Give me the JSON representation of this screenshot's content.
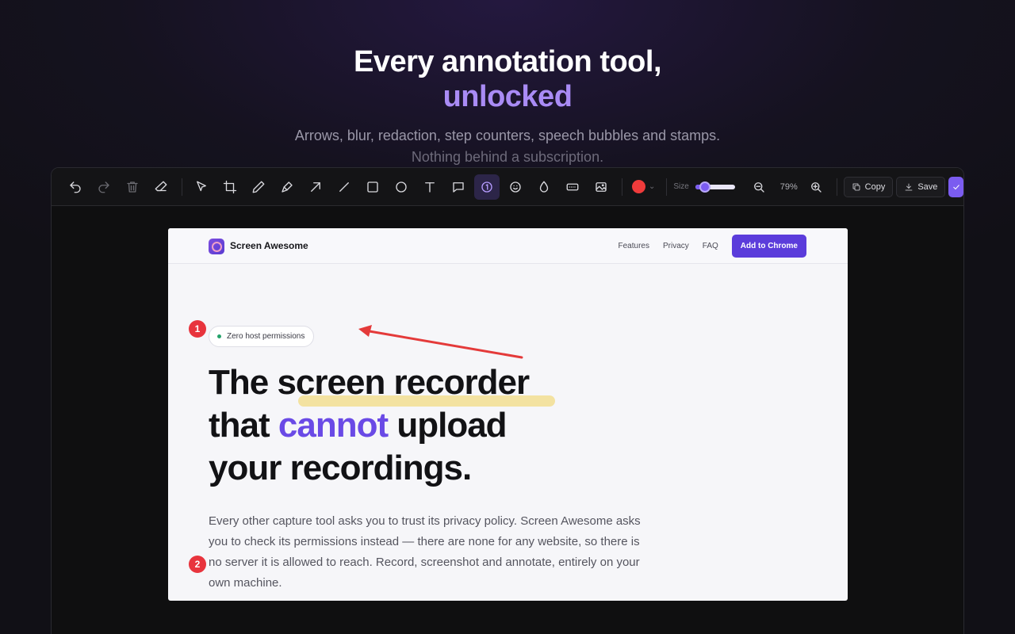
{
  "hero": {
    "title_line1": "Every annotation tool,",
    "title_line2": "unlocked",
    "subtitle_line1": "Arrows, blur, redaction, step counters, speech bubbles and stamps.",
    "subtitle_line2": "Nothing behind a subscription."
  },
  "toolbar": {
    "size_label": "Size",
    "size_value_percent": 25,
    "zoom": "79%",
    "copy_label": "Copy",
    "save_label": "Save",
    "active_tool": "step-counter",
    "stroke_color": "#ef3b3b"
  },
  "site": {
    "brand": "Screen Awesome",
    "nav": [
      "Features",
      "Privacy",
      "FAQ"
    ],
    "cta": "Add to Chrome",
    "badge": "Zero host permissions",
    "headline_line1": "The screen recorder",
    "headline_line2_a": "that ",
    "headline_line2_b": "cannot",
    "headline_line2_c": " upload",
    "headline_line3": "your recordings.",
    "body": "Every other capture tool asks you to trust its privacy policy. Screen Awesome asks you to check its permissions instead — there are none for any website, so there is no server it is allowed to reach. Record, screenshot and annotate, entirely on your own machine."
  },
  "annotations": {
    "step1": "1",
    "step2": "2",
    "arrow_color": "#e43a3a",
    "highlight_color": "#f0d25a"
  },
  "colors": {
    "accent": "#a98bf5",
    "brand_purple": "#5b3cdb",
    "marker_red": "#e8343d"
  }
}
